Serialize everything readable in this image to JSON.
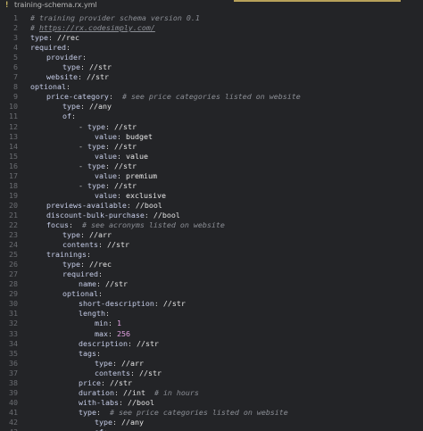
{
  "tab": {
    "icon": "!",
    "title": "training-schema.rx.yml"
  },
  "lines": [
    {
      "num": "1",
      "segments": [
        {
          "indent": 0,
          "text": "# training provider schema version 0.1",
          "kind": "comment"
        }
      ]
    },
    {
      "num": "2",
      "segments": [
        {
          "indent": 0,
          "text": "# ",
          "kind": "comment"
        },
        {
          "text": "https://rx.codesimply.com/",
          "kind": "link"
        }
      ]
    },
    {
      "num": "3",
      "segments": [
        {
          "indent": 0,
          "text": "type",
          "kind": "key"
        },
        {
          "text": ": ",
          "kind": "punct"
        },
        {
          "text": "//rec",
          "kind": "type"
        }
      ]
    },
    {
      "num": "4",
      "segments": [
        {
          "indent": 0,
          "text": "required",
          "kind": "key"
        },
        {
          "text": ":",
          "kind": "punct"
        }
      ]
    },
    {
      "num": "5",
      "segments": [
        {
          "indent": 2,
          "text": "provider",
          "kind": "key"
        },
        {
          "text": ":",
          "kind": "punct"
        }
      ]
    },
    {
      "num": "6",
      "segments": [
        {
          "indent": 4,
          "text": "type",
          "kind": "key"
        },
        {
          "text": ": ",
          "kind": "punct"
        },
        {
          "text": "//str",
          "kind": "type"
        }
      ]
    },
    {
      "num": "7",
      "segments": [
        {
          "indent": 2,
          "text": "website",
          "kind": "key"
        },
        {
          "text": ": ",
          "kind": "punct"
        },
        {
          "text": "//str",
          "kind": "type"
        }
      ]
    },
    {
      "num": "8",
      "segments": [
        {
          "indent": 0,
          "text": "optional",
          "kind": "key"
        },
        {
          "text": ":",
          "kind": "punct"
        }
      ]
    },
    {
      "num": "9",
      "segments": [
        {
          "indent": 2,
          "text": "price-category",
          "kind": "key"
        },
        {
          "text": ":  ",
          "kind": "punct"
        },
        {
          "text": "# see price categories listed on website",
          "kind": "comment"
        }
      ]
    },
    {
      "num": "10",
      "segments": [
        {
          "indent": 4,
          "text": "type",
          "kind": "key"
        },
        {
          "text": ": ",
          "kind": "punct"
        },
        {
          "text": "//any",
          "kind": "type"
        }
      ]
    },
    {
      "num": "11",
      "segments": [
        {
          "indent": 4,
          "text": "of",
          "kind": "key"
        },
        {
          "text": ":",
          "kind": "punct"
        }
      ]
    },
    {
      "num": "12",
      "segments": [
        {
          "indent": 6,
          "text": "- ",
          "kind": "punct"
        },
        {
          "text": "type",
          "kind": "key"
        },
        {
          "text": ": ",
          "kind": "punct"
        },
        {
          "text": "//str",
          "kind": "type"
        }
      ]
    },
    {
      "num": "13",
      "segments": [
        {
          "indent": 8,
          "text": "value",
          "kind": "key"
        },
        {
          "text": ": ",
          "kind": "punct"
        },
        {
          "text": "budget",
          "kind": "str"
        }
      ]
    },
    {
      "num": "14",
      "segments": [
        {
          "indent": 6,
          "text": "- ",
          "kind": "punct"
        },
        {
          "text": "type",
          "kind": "key"
        },
        {
          "text": ": ",
          "kind": "punct"
        },
        {
          "text": "//str",
          "kind": "type"
        }
      ]
    },
    {
      "num": "15",
      "segments": [
        {
          "indent": 8,
          "text": "value",
          "kind": "key"
        },
        {
          "text": ": ",
          "kind": "punct"
        },
        {
          "text": "value",
          "kind": "str"
        }
      ]
    },
    {
      "num": "16",
      "segments": [
        {
          "indent": 6,
          "text": "- ",
          "kind": "punct"
        },
        {
          "text": "type",
          "kind": "key"
        },
        {
          "text": ": ",
          "kind": "punct"
        },
        {
          "text": "//str",
          "kind": "type"
        }
      ]
    },
    {
      "num": "17",
      "segments": [
        {
          "indent": 8,
          "text": "value",
          "kind": "key"
        },
        {
          "text": ": ",
          "kind": "punct"
        },
        {
          "text": "premium",
          "kind": "str"
        }
      ]
    },
    {
      "num": "18",
      "segments": [
        {
          "indent": 6,
          "text": "- ",
          "kind": "punct"
        },
        {
          "text": "type",
          "kind": "key"
        },
        {
          "text": ": ",
          "kind": "punct"
        },
        {
          "text": "//str",
          "kind": "type"
        }
      ]
    },
    {
      "num": "19",
      "segments": [
        {
          "indent": 8,
          "text": "value",
          "kind": "key"
        },
        {
          "text": ": ",
          "kind": "punct"
        },
        {
          "text": "exclusive",
          "kind": "str"
        }
      ]
    },
    {
      "num": "20",
      "segments": [
        {
          "indent": 2,
          "text": "previews-available",
          "kind": "key"
        },
        {
          "text": ": ",
          "kind": "punct"
        },
        {
          "text": "//bool",
          "kind": "type"
        }
      ]
    },
    {
      "num": "21",
      "segments": [
        {
          "indent": 2,
          "text": "discount-bulk-purchase",
          "kind": "key"
        },
        {
          "text": ": ",
          "kind": "punct"
        },
        {
          "text": "//bool",
          "kind": "type"
        }
      ]
    },
    {
      "num": "22",
      "segments": [
        {
          "indent": 2,
          "text": "focus",
          "kind": "key"
        },
        {
          "text": ":  ",
          "kind": "punct"
        },
        {
          "text": "# see acronyms listed on website",
          "kind": "comment"
        }
      ]
    },
    {
      "num": "23",
      "segments": [
        {
          "indent": 4,
          "text": "type",
          "kind": "key"
        },
        {
          "text": ": ",
          "kind": "punct"
        },
        {
          "text": "//arr",
          "kind": "type"
        }
      ]
    },
    {
      "num": "24",
      "segments": [
        {
          "indent": 4,
          "text": "contents",
          "kind": "key"
        },
        {
          "text": ": ",
          "kind": "punct"
        },
        {
          "text": "//str",
          "kind": "type"
        }
      ]
    },
    {
      "num": "25",
      "segments": [
        {
          "indent": 2,
          "text": "trainings",
          "kind": "key"
        },
        {
          "text": ":",
          "kind": "punct"
        }
      ]
    },
    {
      "num": "26",
      "segments": [
        {
          "indent": 4,
          "text": "type",
          "kind": "key"
        },
        {
          "text": ": ",
          "kind": "punct"
        },
        {
          "text": "//rec",
          "kind": "type"
        }
      ]
    },
    {
      "num": "27",
      "segments": [
        {
          "indent": 4,
          "text": "required",
          "kind": "key"
        },
        {
          "text": ":",
          "kind": "punct"
        }
      ]
    },
    {
      "num": "28",
      "segments": [
        {
          "indent": 6,
          "text": "name",
          "kind": "key"
        },
        {
          "text": ": ",
          "kind": "punct"
        },
        {
          "text": "//str",
          "kind": "type"
        }
      ]
    },
    {
      "num": "29",
      "segments": [
        {
          "indent": 4,
          "text": "optional",
          "kind": "key"
        },
        {
          "text": ":",
          "kind": "punct"
        }
      ]
    },
    {
      "num": "30",
      "segments": [
        {
          "indent": 6,
          "text": "short-description",
          "kind": "key"
        },
        {
          "text": ": ",
          "kind": "punct"
        },
        {
          "text": "//str",
          "kind": "type"
        }
      ]
    },
    {
      "num": "31",
      "segments": [
        {
          "indent": 6,
          "text": "length",
          "kind": "key"
        },
        {
          "text": ":",
          "kind": "punct"
        }
      ]
    },
    {
      "num": "32",
      "segments": [
        {
          "indent": 8,
          "text": "min",
          "kind": "key"
        },
        {
          "text": ": ",
          "kind": "punct"
        },
        {
          "text": "1",
          "kind": "num"
        }
      ]
    },
    {
      "num": "33",
      "segments": [
        {
          "indent": 8,
          "text": "max",
          "kind": "key"
        },
        {
          "text": ": ",
          "kind": "punct"
        },
        {
          "text": "256",
          "kind": "num"
        }
      ]
    },
    {
      "num": "34",
      "segments": [
        {
          "indent": 6,
          "text": "description",
          "kind": "key"
        },
        {
          "text": ": ",
          "kind": "punct"
        },
        {
          "text": "//str",
          "kind": "type"
        }
      ]
    },
    {
      "num": "35",
      "segments": [
        {
          "indent": 6,
          "text": "tags",
          "kind": "key"
        },
        {
          "text": ":",
          "kind": "punct"
        }
      ]
    },
    {
      "num": "36",
      "segments": [
        {
          "indent": 8,
          "text": "type",
          "kind": "key"
        },
        {
          "text": ": ",
          "kind": "punct"
        },
        {
          "text": "//arr",
          "kind": "type"
        }
      ]
    },
    {
      "num": "37",
      "segments": [
        {
          "indent": 8,
          "text": "contents",
          "kind": "key"
        },
        {
          "text": ": ",
          "kind": "punct"
        },
        {
          "text": "//str",
          "kind": "type"
        }
      ]
    },
    {
      "num": "38",
      "segments": [
        {
          "indent": 6,
          "text": "price",
          "kind": "key"
        },
        {
          "text": ": ",
          "kind": "punct"
        },
        {
          "text": "//str",
          "kind": "type"
        }
      ]
    },
    {
      "num": "39",
      "segments": [
        {
          "indent": 6,
          "text": "duration",
          "kind": "key"
        },
        {
          "text": ": ",
          "kind": "punct"
        },
        {
          "text": "//int",
          "kind": "type"
        },
        {
          "text": "  # in hours",
          "kind": "comment"
        }
      ]
    },
    {
      "num": "40",
      "segments": [
        {
          "indent": 6,
          "text": "with-labs",
          "kind": "key"
        },
        {
          "text": ": ",
          "kind": "punct"
        },
        {
          "text": "//bool",
          "kind": "type"
        }
      ]
    },
    {
      "num": "41",
      "segments": [
        {
          "indent": 6,
          "text": "type",
          "kind": "key"
        },
        {
          "text": ":  ",
          "kind": "punct"
        },
        {
          "text": "# see price categories listed on website",
          "kind": "comment"
        }
      ]
    },
    {
      "num": "42",
      "segments": [
        {
          "indent": 8,
          "text": "type",
          "kind": "key"
        },
        {
          "text": ": ",
          "kind": "punct"
        },
        {
          "text": "//any",
          "kind": "type"
        }
      ]
    },
    {
      "num": "43",
      "segments": [
        {
          "indent": 8,
          "text": "of",
          "kind": "key"
        },
        {
          "text": ":",
          "kind": "punct"
        }
      ]
    }
  ]
}
